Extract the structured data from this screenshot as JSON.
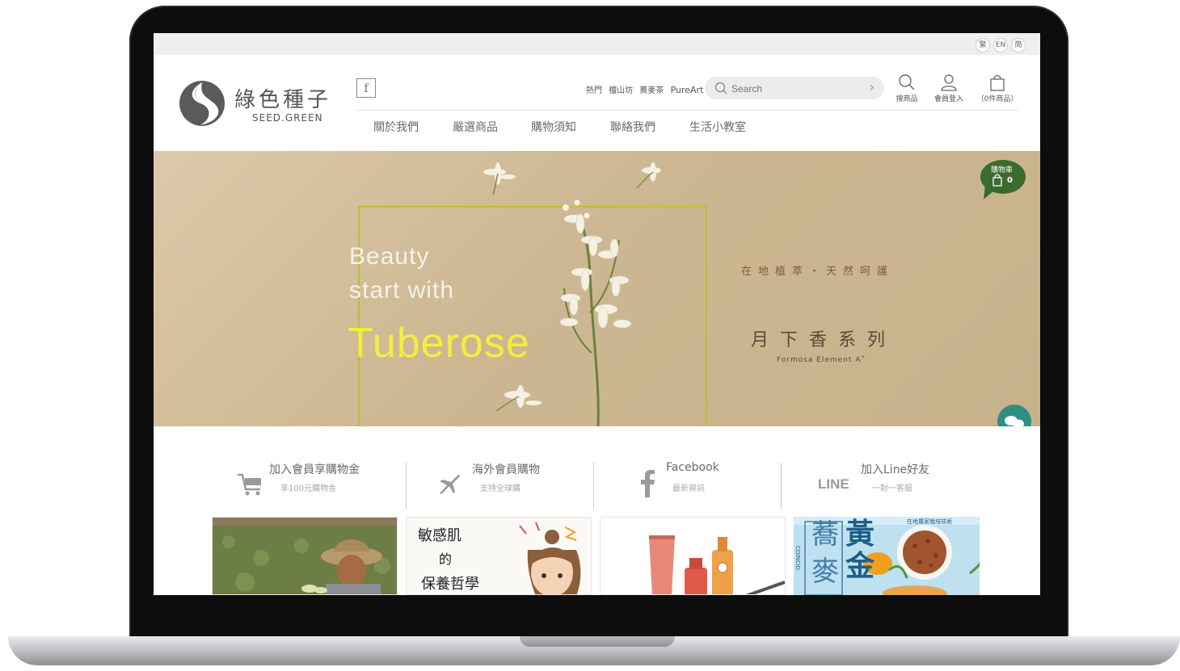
{
  "languages": [
    "繁",
    "EN",
    "簡"
  ],
  "logo": {
    "name_zh": "綠色種子",
    "name_en": "SEED.GREEN"
  },
  "social": {
    "facebook_icon": "f"
  },
  "hot_links": {
    "label": "熱門",
    "items": [
      "檀山坊",
      "蕎麥茶",
      "PureArt"
    ]
  },
  "search": {
    "placeholder": "Search"
  },
  "header_icons": [
    {
      "icon": "search-icon",
      "label": "搜商品"
    },
    {
      "icon": "user-icon",
      "label": "會員登入"
    },
    {
      "icon": "bag-icon",
      "label": "（0件商品）"
    }
  ],
  "nav": [
    "關於我們",
    "嚴選商品",
    "購物須知",
    "聯絡我們",
    "生活小教室"
  ],
  "hero": {
    "line1": "Beauty",
    "line2": "start with",
    "highlight": "Tuberose",
    "tagline": "在地植萃・天然呵護",
    "series": "月下香系列",
    "series_en": "Formosa Element A",
    "series_en_sup": "+"
  },
  "cart_bubble": {
    "label": "購物車",
    "count": "0"
  },
  "features": [
    {
      "icon": "cart-icon",
      "title": "加入會員享購物金",
      "subtitle": "享100元購物金"
    },
    {
      "icon": "plane-icon",
      "title": "海外會員購物",
      "subtitle": "支持全球購"
    },
    {
      "icon": "facebook-icon",
      "title": "Facebook",
      "subtitle": "最新資訊"
    },
    {
      "icon": "line-icon",
      "icon_text": "LINE",
      "title": "加入Line好友",
      "subtitle": "一對一客服"
    }
  ],
  "thumbnails": [
    {
      "name": "farmer-photo"
    },
    {
      "name": "sensitive-skin",
      "text_line1": "敏感肌",
      "text_line2": "的",
      "text_line3": "保養哲學"
    },
    {
      "name": "product-bottles"
    },
    {
      "name": "golden-buckwheat",
      "text_big1": "黃",
      "text_big2": "金",
      "text_side1": "蕎",
      "text_side2": "麥",
      "text_tag": "在地農家栽培技術",
      "text_vertical": "COINCID"
    }
  ],
  "colors": {
    "accent_green": "#b9c034",
    "tuberose_yellow": "#f3ee3c",
    "bubble_green": "#3c6b2e",
    "chat_teal": "#2f8e82"
  }
}
